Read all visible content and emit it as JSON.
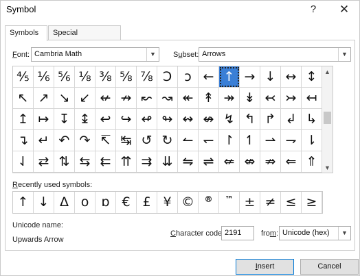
{
  "title": "Symbol",
  "title_buttons": {
    "help": "?",
    "close": "✕"
  },
  "tabs": [
    {
      "label": "Symbols",
      "active": true
    },
    {
      "label": "Special Characters",
      "active": false
    }
  ],
  "font": {
    "label_u": "F",
    "label_rest": "ont:",
    "value": "Cambria Math"
  },
  "subset": {
    "label_pre": "S",
    "label_u": "u",
    "label_rest": "bset:",
    "value": "Arrows"
  },
  "grid": {
    "selected": {
      "row": 0,
      "col": 10
    },
    "rows": [
      [
        "⅘",
        "⅙",
        "⅚",
        "⅛",
        "⅜",
        "⅝",
        "⅞",
        "Ↄ",
        "ↄ",
        "←",
        "↑",
        "→",
        "↓",
        "↔",
        "↕"
      ],
      [
        "↖",
        "↗",
        "↘",
        "↙",
        "↚",
        "↛",
        "↜",
        "↝",
        "↞",
        "↟",
        "↠",
        "↡",
        "↢",
        "↣",
        "↤"
      ],
      [
        "↥",
        "↦",
        "↧",
        "↨",
        "↩",
        "↪",
        "↫",
        "↬",
        "↭",
        "↮",
        "↯",
        "↰",
        "↱",
        "↲",
        "↳"
      ],
      [
        "↴",
        "↵",
        "↶",
        "↷",
        "↸",
        "↹",
        "↺",
        "↻",
        "↼",
        "↽",
        "↾",
        "↿",
        "⇀",
        "⇁",
        "⇂"
      ],
      [
        "⇃",
        "⇄",
        "⇅",
        "⇆",
        "⇇",
        "⇈",
        "⇉",
        "⇊",
        "⇋",
        "⇌",
        "⇍",
        "⇎",
        "⇏",
        "⇐",
        "⇑"
      ]
    ]
  },
  "recent": {
    "label_pre": "",
    "label_u": "R",
    "label_rest": "ecently used symbols:",
    "symbols": [
      "↑",
      "↓",
      "Δ",
      "o",
      "ɒ",
      "€",
      "£",
      "¥",
      "©",
      "®",
      "™",
      "±",
      "≠",
      "≤",
      "≥"
    ]
  },
  "unicode_name": {
    "label": "Unicode name:",
    "value": "Upwards Arrow"
  },
  "char_code": {
    "label_u": "C",
    "label_rest": "haracter code:",
    "value": "2191"
  },
  "from": {
    "label_pre": "fro",
    "label_u": "m",
    "label_rest": ":",
    "value": "Unicode (hex)"
  },
  "buttons": {
    "insert_u": "I",
    "insert_rest": "nsert",
    "cancel": "Cancel"
  },
  "colors": {
    "selection": "#3a7fd6",
    "default_button_border": "#0078d7"
  }
}
